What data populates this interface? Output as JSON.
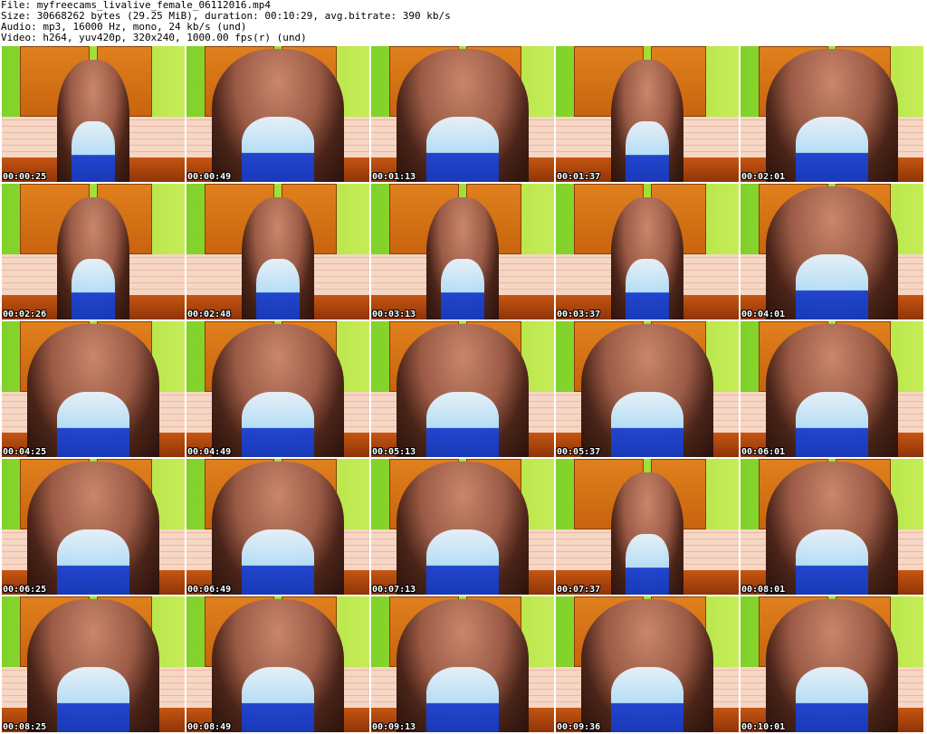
{
  "header": {
    "file_line": "File: myfreecams_livalive_female_06112016.mp4",
    "size_line": "Size: 30668262 bytes (29.25 MiB), duration: 00:10:29, avg.bitrate: 390 kb/s",
    "audio_line": "Audio: mp3, 16000 Hz, mono, 24 kb/s (und)",
    "video_line": "Video: h264, yuv420p, 320x240, 1000.00 fps(r) (und)"
  },
  "thumbnails": [
    {
      "timestamp": "00:00:25"
    },
    {
      "timestamp": "00:00:49"
    },
    {
      "timestamp": "00:01:13"
    },
    {
      "timestamp": "00:01:37"
    },
    {
      "timestamp": "00:02:01"
    },
    {
      "timestamp": "00:02:26"
    },
    {
      "timestamp": "00:02:48"
    },
    {
      "timestamp": "00:03:13"
    },
    {
      "timestamp": "00:03:37"
    },
    {
      "timestamp": "00:04:01"
    },
    {
      "timestamp": "00:04:25"
    },
    {
      "timestamp": "00:04:49"
    },
    {
      "timestamp": "00:05:13"
    },
    {
      "timestamp": "00:05:37"
    },
    {
      "timestamp": "00:06:01"
    },
    {
      "timestamp": "00:06:25"
    },
    {
      "timestamp": "00:06:49"
    },
    {
      "timestamp": "00:07:13"
    },
    {
      "timestamp": "00:07:37"
    },
    {
      "timestamp": "00:08:01"
    },
    {
      "timestamp": "00:08:25"
    },
    {
      "timestamp": "00:08:49"
    },
    {
      "timestamp": "00:09:13"
    },
    {
      "timestamp": "00:09:36"
    },
    {
      "timestamp": "00:10:01"
    }
  ]
}
